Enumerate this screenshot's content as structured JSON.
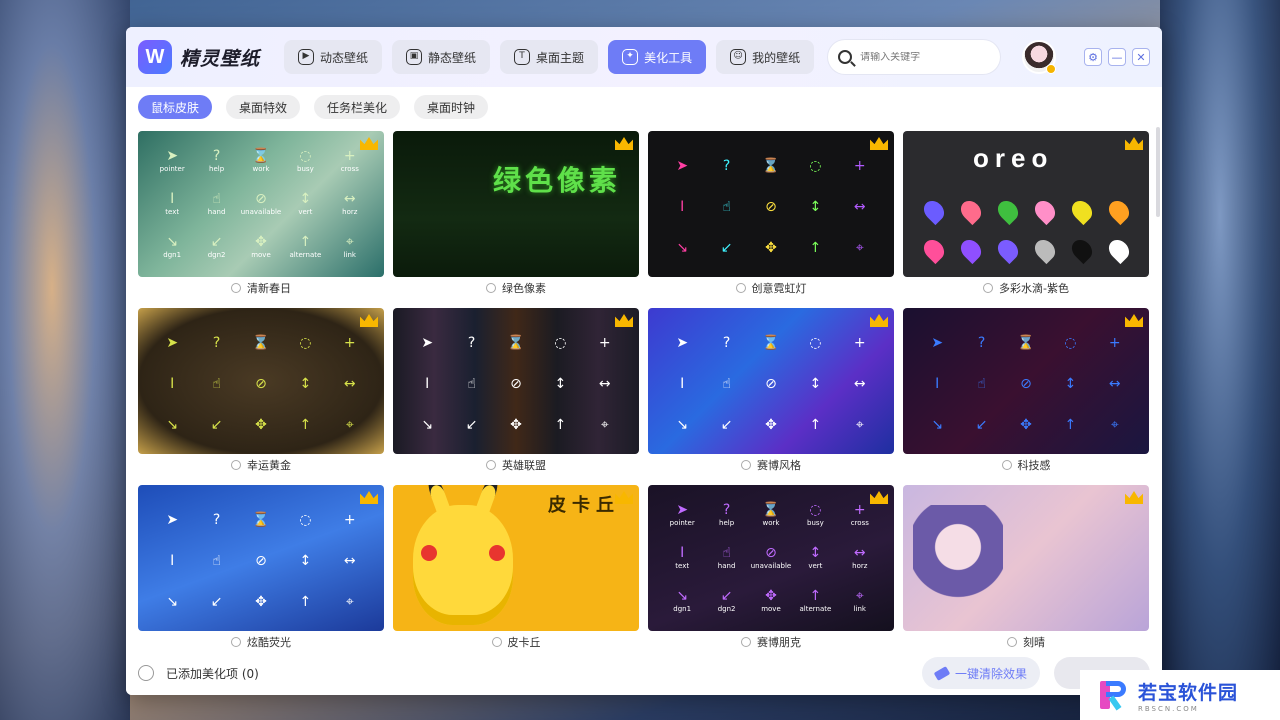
{
  "app": {
    "title": "精灵壁纸",
    "logo_letter": "W"
  },
  "nav": [
    {
      "label": "动态壁纸",
      "icon": "play-circle-icon",
      "active": false
    },
    {
      "label": "静态壁纸",
      "icon": "image-icon",
      "active": false
    },
    {
      "label": "桌面主题",
      "icon": "shirt-icon",
      "active": false
    },
    {
      "label": "美化工具",
      "icon": "magic-icon",
      "active": true
    },
    {
      "label": "我的壁纸",
      "icon": "smile-icon",
      "active": false
    }
  ],
  "search": {
    "placeholder": "请输入关键字",
    "value": ""
  },
  "subtabs": [
    {
      "label": "鼠标皮肤",
      "active": true
    },
    {
      "label": "桌面特效",
      "active": false
    },
    {
      "label": "任务栏美化",
      "active": false
    },
    {
      "label": "桌面时钟",
      "active": false
    }
  ],
  "cards": [
    {
      "name": "清新春日",
      "premium": true,
      "bg": "linear-gradient(135deg,#2f6f63,#7fb59b 40%,#a8cbb4 60%,#2b6f6a)"
    },
    {
      "name": "绿色像素",
      "premium": true,
      "bg": "linear-gradient(180deg,#0a1a0a,#132a12 60%,#0b1b0b)",
      "title_text": "绿色像素"
    },
    {
      "name": "创意霓虹灯",
      "premium": true,
      "bg": "#121214"
    },
    {
      "name": "多彩水滴-紫色",
      "premium": true,
      "bg": "#2b2b2e",
      "title_text": "oreo"
    },
    {
      "name": "幸运黄金",
      "premium": true,
      "bg": "radial-gradient(ellipse at center,#4a3a24 0%,#2e2416 70%,#c6a04a 100%)"
    },
    {
      "name": "英雄联盟",
      "premium": true,
      "bg": "linear-gradient(90deg,#1a1a24,#3a2a40,#1a2030,#402818,#1b1b22,#302436,#1c1c26)"
    },
    {
      "name": "赛博风格",
      "premium": true,
      "bg": "linear-gradient(135deg,#3d3ad0,#2a6ae0 40%,#5b2fc6 70%,#1e2fa0)"
    },
    {
      "name": "科技感",
      "premium": true,
      "bg": "linear-gradient(135deg,#1a1030,#3a1030 50%,#1a1640)"
    },
    {
      "name": "炫酷荧光",
      "premium": true,
      "bg": "linear-gradient(160deg,#1e4db8,#3f7de6 50%,#1c3a9a)"
    },
    {
      "name": "皮卡丘",
      "premium": true,
      "bg": "#f6b416",
      "title_text": "皮卡丘"
    },
    {
      "name": "赛博朋克",
      "premium": true,
      "bg": "linear-gradient(160deg,#1a1226,#2a1a3a 60%,#14101e)"
    },
    {
      "name": "刻晴",
      "premium": true,
      "bg": "linear-gradient(135deg,#c9b7e0,#e9c4d2 50%,#b9a4d8)"
    }
  ],
  "cursor_labels": [
    "pointer",
    "help",
    "work",
    "busy",
    "cross",
    "text",
    "hand",
    "unavailable",
    "vert",
    "horz",
    "dgn1",
    "dgn2",
    "move",
    "alternate",
    "link"
  ],
  "footer": {
    "label": "已添加美化项 (0)",
    "clear_label": "一键清除效果"
  },
  "watermark": {
    "title": "若宝软件园",
    "sub": "RBSCN.COM"
  }
}
